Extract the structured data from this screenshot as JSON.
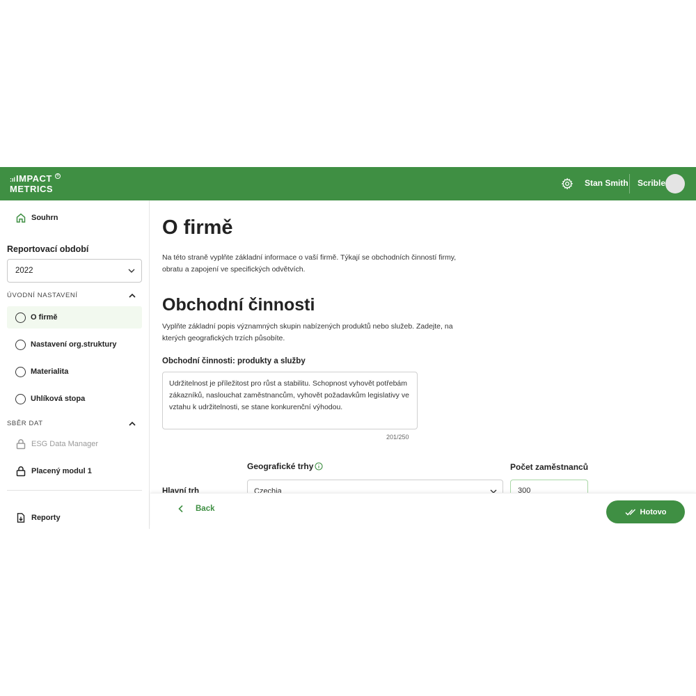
{
  "header": {
    "logo_top": "IMPACT",
    "logo_bottom": "METRICS",
    "logo_dots": ":ıl",
    "logo_reg": "®",
    "settings_icon": "gear-icon",
    "user_name": "Stan Smith",
    "company": "Scrible",
    "brand_color": "#3f8f43"
  },
  "sidebar": {
    "overview": "Souhrn",
    "period_label": "Reportovací období",
    "period_value": "2022",
    "section_setup": "ÚVODNÍ NASTAVENÍ",
    "setup_items": [
      {
        "label": "O firmě",
        "active": true
      },
      {
        "label": "Nastavení org.struktury"
      },
      {
        "label": "Materialita"
      },
      {
        "label": "Uhlíková stopa"
      }
    ],
    "section_data": "SBĚR DAT",
    "data_items": [
      {
        "label": "ESG Data Manager",
        "locked": true,
        "disabled": true
      },
      {
        "label": "Placený modul 1",
        "locked": true
      }
    ],
    "reports": "Reporty"
  },
  "main": {
    "title": "O firmě",
    "intro": "Na této straně vyplňte základní informace o vaší firmě. Týkají se obchodních činností firmy, obratu a zapojení ve specifických odvětvích.",
    "section_title": "Obchodní činnosti",
    "section_desc": "Vyplňte základní popis významných skupin nabízených produktů nebo služeb. Zadejte, na kterých geografických trzích působíte.",
    "activities_label": "Obchodní činnosti: produkty a služby",
    "activities_value": "Udržitelnost je příležitost pro růst a stabilitu. Schopnost vyhovět potřebám zákazníků, naslouchat zaměstnancům, vyhovět požadavkům legislativy ve vztahu k udržitelnosti, se stane konkurenční výhodou.",
    "char_counter": "201/250",
    "geo_label": "Geografické trhy",
    "employees_label": "Počet zaměstnanců",
    "main_market_label": "Hlavní trh",
    "geo_value": "Czechia",
    "employees_value": "300"
  },
  "footer": {
    "back": "Back",
    "done": "Hotovo"
  }
}
